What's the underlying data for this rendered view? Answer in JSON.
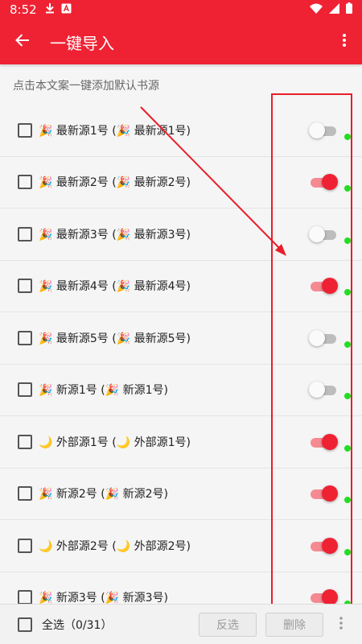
{
  "status_bar": {
    "time": "8:52",
    "download_icon": "download-icon",
    "notification_icon": "a-notification-icon",
    "wifi_icon": "wifi-icon",
    "signal_icon": "signal-icon",
    "battery_icon": "battery-icon"
  },
  "app_bar": {
    "title": "一键导入",
    "back_icon": "arrow-left-icon",
    "more_icon": "more-vert-icon",
    "color": "#ee2233"
  },
  "hint": "点击本文案一键添加默认书源",
  "items": [
    {
      "label": "🎉 最新源1号 (🎉 最新源1号)",
      "checked": false,
      "enabled": false
    },
    {
      "label": "🎉 最新源2号 (🎉 最新源2号)",
      "checked": false,
      "enabled": true
    },
    {
      "label": "🎉 最新源3号 (🎉 最新源3号)",
      "checked": false,
      "enabled": false
    },
    {
      "label": "🎉 最新源4号 (🎉 最新源4号)",
      "checked": false,
      "enabled": true
    },
    {
      "label": "🎉 最新源5号 (🎉 最新源5号)",
      "checked": false,
      "enabled": false
    },
    {
      "label": "🎉 新源1号 (🎉 新源1号)",
      "checked": false,
      "enabled": false
    },
    {
      "label": "🌙 外部源1号 (🌙 外部源1号)",
      "checked": false,
      "enabled": true
    },
    {
      "label": "🎉 新源2号 (🎉 新源2号)",
      "checked": false,
      "enabled": true
    },
    {
      "label": "🌙 外部源2号 (🌙 外部源2号)",
      "checked": false,
      "enabled": true
    },
    {
      "label": "🎉 新源3号 (🎉 新源3号)",
      "checked": false,
      "enabled": true
    }
  ],
  "bottom_bar": {
    "select_all_label": "全选（0/31）",
    "invert_label": "反选",
    "delete_label": "删除",
    "more_icon": "more-vert-icon"
  },
  "colors": {
    "accent": "#ee2233",
    "switch_on_track": "#f58a92",
    "status_dot": "#22dd22",
    "annotation": "#e81e2a"
  }
}
